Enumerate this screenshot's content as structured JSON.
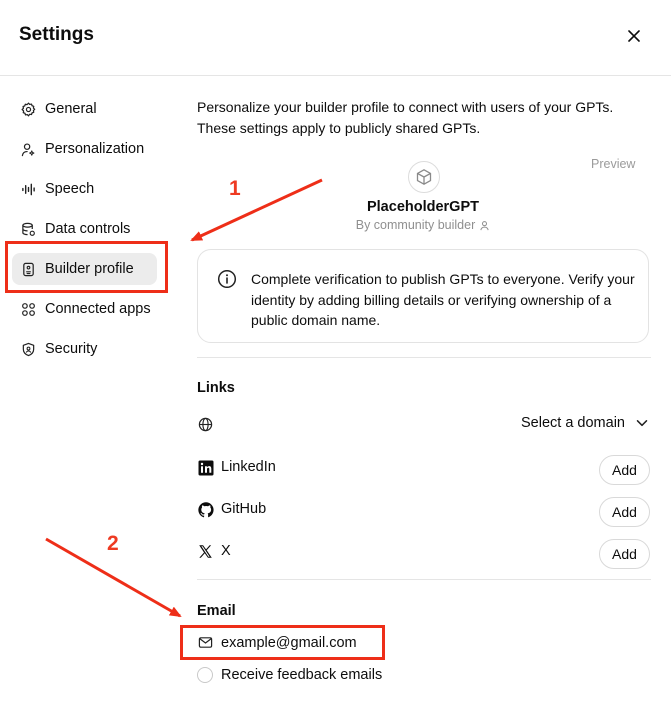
{
  "header": {
    "title": "Settings"
  },
  "sidebar": {
    "items": [
      {
        "label": "General",
        "icon": "gear-icon"
      },
      {
        "label": "Personalization",
        "icon": "person-sparkle-icon"
      },
      {
        "label": "Speech",
        "icon": "waveform-icon"
      },
      {
        "label": "Data controls",
        "icon": "database-icon"
      },
      {
        "label": "Builder profile",
        "icon": "id-badge-icon",
        "active": true
      },
      {
        "label": "Connected apps",
        "icon": "apps-grid-icon"
      },
      {
        "label": "Security",
        "icon": "shield-icon"
      }
    ]
  },
  "main": {
    "intro": "Personalize your builder profile to connect with users of your GPTs. These settings apply to publicly shared GPTs.",
    "preview": {
      "label": "Preview",
      "gpt_name": "PlaceholderGPT",
      "by": "By community builder"
    },
    "notice": "Complete verification to publish GPTs to everyone. Verify your identity by adding billing details or verifying ownership of a public domain name.",
    "links": {
      "title": "Links",
      "domain_select": "Select a domain",
      "items": [
        {
          "label": "LinkedIn",
          "icon": "linkedin-icon",
          "button": "Add"
        },
        {
          "label": "GitHub",
          "icon": "github-icon",
          "button": "Add"
        },
        {
          "label": "X",
          "icon": "x-icon",
          "button": "Add"
        }
      ]
    },
    "email": {
      "title": "Email",
      "address": "example@gmail.com",
      "feedback_label": "Receive feedback emails"
    }
  },
  "annotations": {
    "one": "1",
    "two": "2"
  },
  "colors": {
    "annotation": "#ee2e18",
    "active_nav_bg": "#ececec"
  }
}
